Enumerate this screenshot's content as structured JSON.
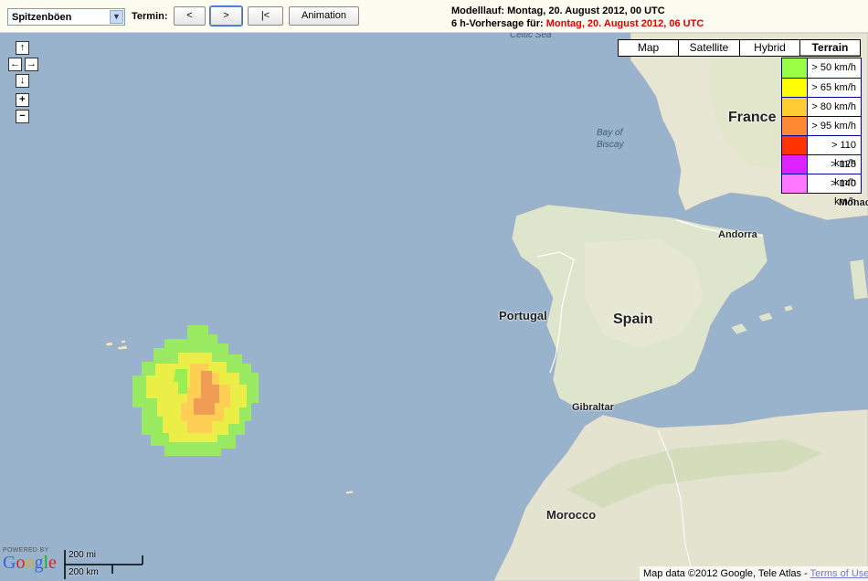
{
  "toolbar": {
    "parameter_select": "Spitzenböen",
    "termin_label": "Termin:",
    "prev_label": "<",
    "next_label": ">",
    "first_label": "|<",
    "animation_label": "Animation",
    "run_label": "Modelllauf: Montag, 20. August 2012, 00 UTC",
    "forecast_prefix": "6 h-Vorhersage für:",
    "forecast_time": "Montag, 20. August 2012, 06 UTC"
  },
  "map_types": [
    {
      "label": "Map",
      "active": false
    },
    {
      "label": "Satellite",
      "active": false
    },
    {
      "label": "Hybrid",
      "active": false
    },
    {
      "label": "Terrain",
      "active": true
    }
  ],
  "legend": [
    {
      "label": "> 50 km/h",
      "color": "#99ff44"
    },
    {
      "label": "> 65 km/h",
      "color": "#ffff00"
    },
    {
      "label": "> 80 km/h",
      "color": "#ffcc33"
    },
    {
      "label": "> 95 km/h",
      "color": "#ff8833"
    },
    {
      "label": "> 110 km/h",
      "color": "#ff3300"
    },
    {
      "label": "> 125 km/h",
      "color": "#dd22ff"
    },
    {
      "label": "> 140 km/h",
      "color": "#ff77ff"
    }
  ],
  "nav_icons": [
    "arrow-up-icon",
    "arrow-left-icon",
    "arrow-right-icon",
    "arrow-down-icon",
    "zoom-in-icon",
    "zoom-out-icon"
  ],
  "map_labels": {
    "celtic_sea": "Celtic Sea",
    "bay_of_biscay_1": "Bay of",
    "bay_of_biscay_2": "Biscay",
    "france": "France",
    "monaco": "Monac",
    "andorra": "Andorra",
    "portugal": "Portugal",
    "spain": "Spain",
    "gibraltar": "Gibraltar",
    "morocco": "Morocco"
  },
  "bottom": {
    "powered_by": "POWERED BY",
    "google": "Google",
    "scale_mi": "200 mi",
    "scale_km": "200 km",
    "attribution": "Map data ©2012 Google, Tele Atlas - ",
    "terms": "Terms of Use"
  },
  "colors": {
    "sea": "#99b3cc",
    "land": "#e8e8d8",
    "land_green": "#d8e5c5",
    "forecast_red": "#e00000"
  }
}
